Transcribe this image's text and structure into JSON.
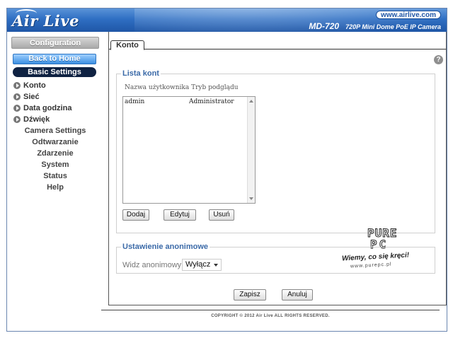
{
  "header": {
    "brand": "Air Live",
    "website": "www.airlive.com",
    "model": "MD-720",
    "model_description": "720P Mini Dome PoE IP Camera"
  },
  "sidebar": {
    "configuration_label": "Configuration",
    "back_label": "Back to Home",
    "basic_label": "Basic Settings",
    "basic_items": [
      {
        "label": "Konto"
      },
      {
        "label": "Sieć"
      },
      {
        "label": "Data godzina"
      },
      {
        "label": "Dźwięk"
      }
    ],
    "sections": [
      {
        "label": "Camera Settings"
      },
      {
        "label": "Odtwarzanie"
      },
      {
        "label": "Zdarzenie"
      },
      {
        "label": "System"
      },
      {
        "label": "Status"
      },
      {
        "label": "Help"
      }
    ]
  },
  "main": {
    "active_tab": "Konto",
    "help_glyph": "?",
    "accounts": {
      "legend": "Lista kont",
      "columns_header": "Nazwa użytkownika Tryb podglądu",
      "rows": [
        {
          "user": "admin",
          "role": "Administrator"
        }
      ],
      "buttons": {
        "add": "Dodaj",
        "edit": "Edytuj",
        "delete": "Usuń"
      }
    },
    "anonymous": {
      "legend": "Ustawienie anonimowe",
      "label": "Widz anonimowy",
      "selected": "Wyłącz"
    },
    "save_label": "Zapisz",
    "cancel_label": "Anuluj"
  },
  "watermark": {
    "line1": "PURE",
    "line2": "PC",
    "slogan": "Wiemy, co się kręci!",
    "url": "www.purepc.pl"
  },
  "footer": {
    "copyright": "COPYRIGHT © 2012 Air Live ALL RIGHTS RESERVED."
  },
  "colors": {
    "header_blue": "#2f6fc3",
    "legend_blue": "#3b6aa8",
    "basic_settings_bg": "#0f2242"
  }
}
